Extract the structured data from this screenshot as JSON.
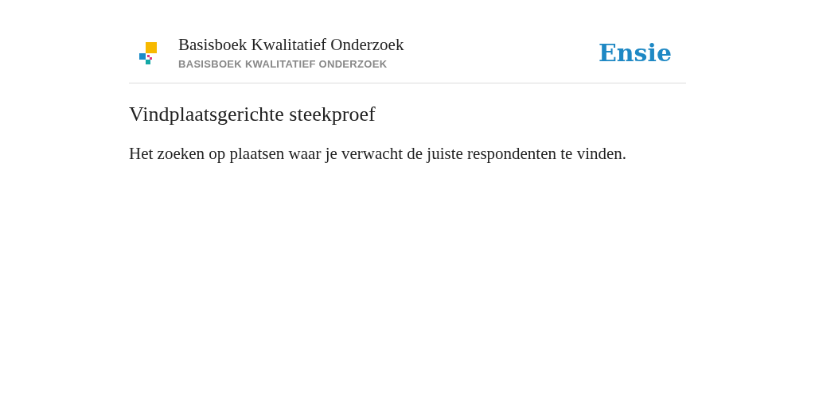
{
  "header": {
    "title": "Basisboek Kwalitatief Onderzoek",
    "subtitle": "BASISBOEK KWALITATIEF ONDERZOEK",
    "brand": "Ensie"
  },
  "entry": {
    "term": "Vindplaatsgerichte steekproef",
    "definition": "Het zoeken op plaatsen waar je verwacht de juiste respondenten te vinden."
  }
}
